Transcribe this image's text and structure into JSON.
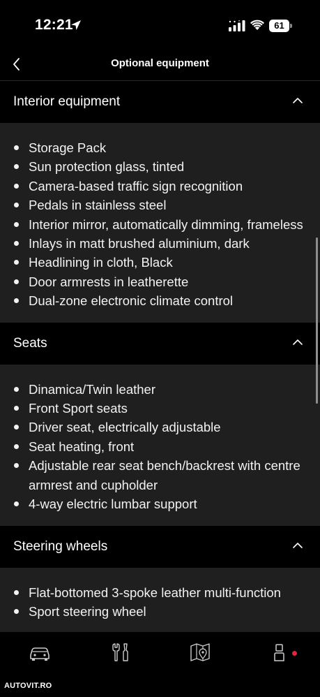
{
  "status_bar": {
    "time": "12:21",
    "battery_level": "61",
    "icons": [
      "location-arrow-icon",
      "signal-icon",
      "wifi-icon",
      "battery-icon"
    ]
  },
  "header": {
    "title": "Optional equipment",
    "back_icon": "chevron-left-icon"
  },
  "sections": [
    {
      "title": "Interior equipment",
      "expanded": true,
      "items": [
        "Storage Pack",
        "Sun protection glass, tinted",
        "Camera-based traffic sign recognition",
        "Pedals in stainless steel",
        "Interior mirror, automatically dimming, frameless",
        "Inlays in matt brushed aluminium, dark",
        "Headlining in cloth, Black",
        "Door armrests in leatherette",
        "Dual-zone electronic climate control"
      ]
    },
    {
      "title": "Seats",
      "expanded": true,
      "items": [
        "Dinamica/Twin leather",
        "Front Sport seats",
        "Driver seat, electrically adjustable",
        "Seat heating, front",
        "Adjustable rear seat bench/backrest with centre armrest and cupholder",
        "4-way electric lumbar support"
      ]
    },
    {
      "title": "Steering wheels",
      "expanded": true,
      "items": [
        "Flat-bottomed 3-spoke leather multi-function",
        "Sport steering wheel"
      ]
    }
  ],
  "tab_bar": {
    "tabs": [
      "car-icon",
      "tools-icon",
      "map-icon",
      "profile-icon"
    ],
    "notification_color": "#e3243b"
  },
  "watermark": "AUTOVIT.RO",
  "colors": {
    "background": "#000000",
    "section_body": "#1f1f1f",
    "text": "#f2f2f2"
  }
}
